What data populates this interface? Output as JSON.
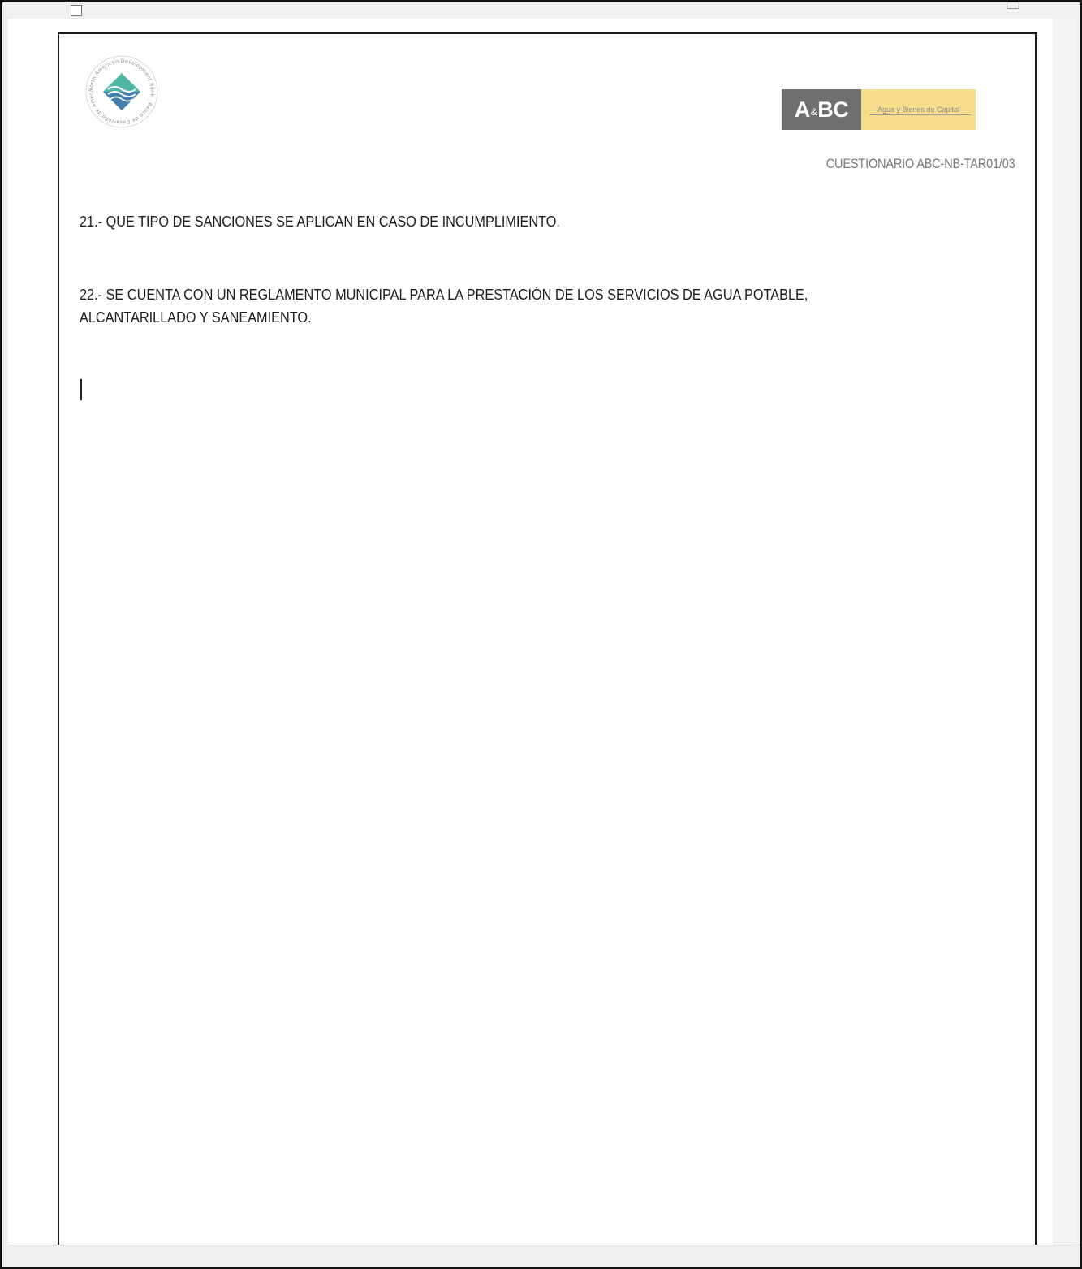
{
  "header": {
    "left_logo": {
      "name": "development-bank-seal",
      "ring_text": "North American Development Bank · Banco de Desarrollo de América del Norte",
      "colors": {
        "diamond_teal": "#4fb6a3",
        "diamond_blue": "#3f74b0",
        "ring_gray": "#8a8a8a"
      }
    },
    "right_logo": {
      "mark_text_a": "A",
      "mark_text_amp": "&",
      "mark_text_bc": "BC",
      "tagline": "Agua y Bienes de Capital",
      "colors": {
        "mark_bg": "#6f6f6f",
        "tagline_bg": "#f7dc8c"
      }
    },
    "document_code": "CUESTIONARIO ABC-NB-TAR01/03"
  },
  "questions": [
    {
      "number": "21",
      "lines": [
        "21.- QUE TIPO DE SANCIONES SE APLICAN EN CASO DE INCUMPLIMIENTO."
      ]
    },
    {
      "number": "22",
      "lines": [
        "22.- SE CUENTA CON UN REGLAMENTO MUNICIPAL PARA LA PRESTACIÓN DE LOS SERVICIOS DE AGUA POTABLE,",
        "ALCANTARILLADO Y SANEAMIENTO."
      ]
    }
  ]
}
